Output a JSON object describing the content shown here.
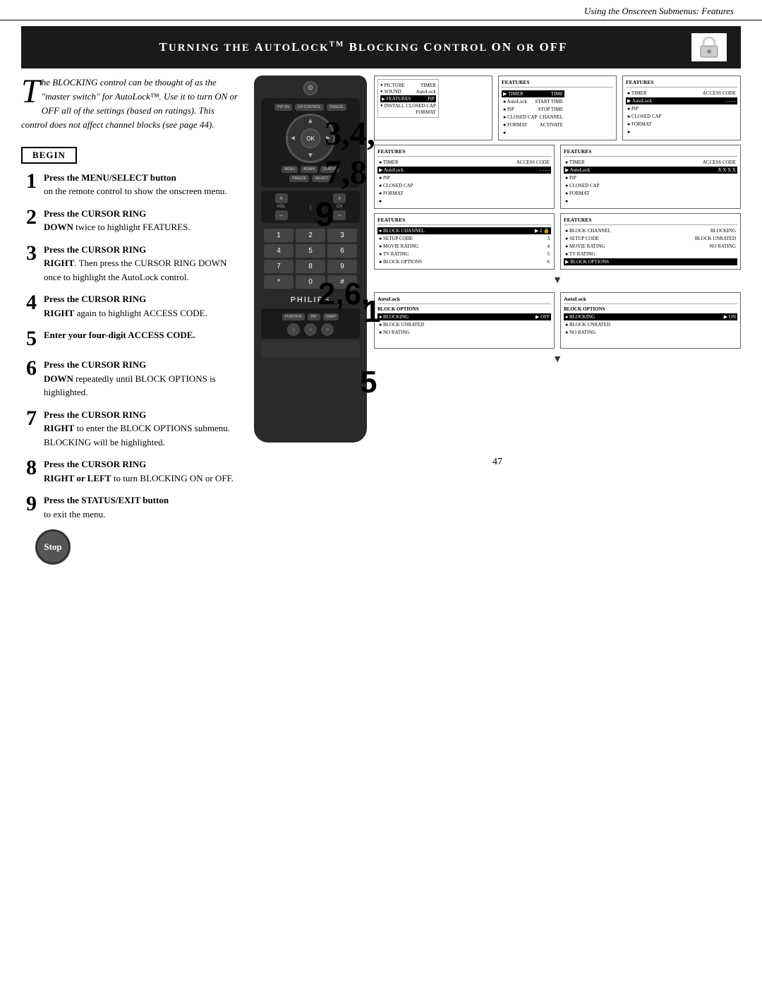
{
  "header": {
    "text": "Using the Onscreen Submenus: Features"
  },
  "title": {
    "text": "Turning the AutoLock",
    "trademark": "TM",
    "text2": " Blocking Control on or Off"
  },
  "intro": {
    "drop_cap": "T",
    "line1": "he BLOCKING control can be thought",
    "line2": "of as the \"master switch\" for",
    "line3": "AutoLock™. Use it to turn ON or OFF all",
    "line4": "of the settings (based on ratings). This con-",
    "line5": "trol does not affect channel blocks",
    "line6": "see page 44)."
  },
  "begin_label": "BEGIN",
  "steps": [
    {
      "number": "1",
      "bold": "Press the MENU/SELECT button",
      "text": "on the remote control to show the onscreen menu."
    },
    {
      "number": "2",
      "bold": "Press the CURSOR RING",
      "text": "DOWN twice to highlight FEATURES."
    },
    {
      "number": "3",
      "bold": "Press the CURSOR RING",
      "text": "RIGHT. Then press the CURSOR RING DOWN once to highlight the AutoLock control."
    },
    {
      "number": "4",
      "bold": "Press the CURSOR RING",
      "text": "RIGHT again to highlight ACCESS CODE."
    },
    {
      "number": "5",
      "bold": "Enter your four-digit ACCESS CODE."
    },
    {
      "number": "6",
      "bold": "Press the CURSOR RING",
      "text": "DOWN repeatedly until BLOCK OPTIONS is highlighted."
    },
    {
      "number": "7",
      "bold": "Press the CURSOR RING",
      "text": "RIGHT to enter the BLOCK OPTIONS submenu. BLOCKING will be highlighted."
    },
    {
      "number": "8",
      "bold": "Press the CURSOR RING",
      "text": "RIGHT or LEFT to turn BLOCKING ON or OFF."
    },
    {
      "number": "9",
      "bold": "Press the STATUS/EXIT button",
      "text": "to exit the menu."
    }
  ],
  "stop_label": "Stop",
  "page_number": "47",
  "screens": {
    "top_left": {
      "title": "FEATURES",
      "items": [
        "TIMER",
        "AutoLock",
        "PiP",
        "CLOSED CAP",
        "FORMAT"
      ],
      "menu_items": [
        "PICTURE",
        "SOUND",
        "FEATURES",
        "INSTALL"
      ],
      "right_items": [
        "TIMER",
        "AutoLock",
        "PiP",
        "CLOSED CAP",
        "FORMAT"
      ],
      "highlighted": "FEATURES"
    },
    "top_right": {
      "title": "FEATURES",
      "items": [
        "TIMER",
        "AutoLock",
        "PiP",
        "CLOSED CAP",
        "FORMAT"
      ],
      "values": [
        "TIME",
        "START TIME",
        "STOP TIME",
        "CHANNEL",
        "ACTIVATE"
      ],
      "highlighted": "TIMER"
    },
    "mid_left": {
      "title": "FEATURES",
      "items": [
        "TIMER",
        "AutoLock",
        "PiP",
        "CLOSED CAP",
        "FORMAT"
      ],
      "highlighted": "AutoLock",
      "access_code": "- - - -"
    },
    "mid_right": {
      "title": "FEATURES",
      "items": [
        "TIMER",
        "AutoLock",
        "PiP",
        "CLOSED CAP",
        "FORMAT"
      ],
      "highlighted": "AutoLock",
      "access_code": "X X X X"
    },
    "lower_left": {
      "title": "AutoLock",
      "items": [
        "BLOCK CHANNEL",
        "SETUP CODE",
        "MOVIE RATING",
        "TV RATING",
        "BLOCK OPTIONS"
      ],
      "values": [
        "2",
        "3",
        "4",
        "5",
        "6"
      ],
      "highlighted": "BLOCK CHANNEL"
    },
    "lower_right": {
      "title": "AutoLock",
      "items": [
        "BLOCK CHANNEL",
        "SETUP CODE",
        "MOVIE RATING",
        "TV RATING",
        "BLOCK OPTIONS"
      ],
      "values": [
        "BLOCKING",
        "BLOCK UNRATED",
        "NO RATING"
      ],
      "highlighted": "BLOCK OPTIONS"
    },
    "bottom_left": {
      "title": "AutoLock",
      "items": [
        "BLOCK OPTIONS"
      ],
      "sub_items": [
        "BLOCKING",
        "BLOCK UNRATED",
        "NO RATING"
      ],
      "blocking_value": "OFF",
      "highlighted": "BLOCKING"
    },
    "bottom_right": {
      "title": "AutoLock",
      "items": [
        "BLOCK OPTIONS"
      ],
      "sub_items": [
        "BLOCKING",
        "BLOCK UNRATED",
        "NO RATING"
      ],
      "blocking_value": "ON",
      "highlighted": "BLOCKING"
    }
  },
  "philips_logo": "PHILIPS",
  "remote_labels": {
    "power": "PWR",
    "menu": "MENU SELECT",
    "pip_on": "PiP ON",
    "ch_control": "CH CONTROL",
    "freeze": "FREEZE",
    "status": "STATUS",
    "select": "SELECT",
    "position": "POSITION",
    "pip": "PiP",
    "swap": "SWAP"
  }
}
